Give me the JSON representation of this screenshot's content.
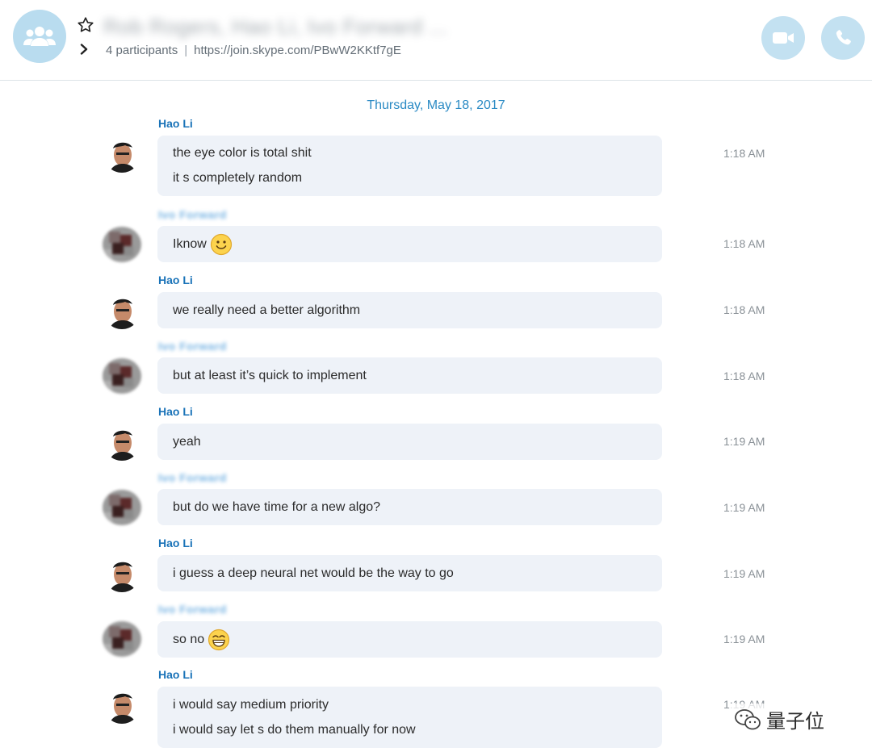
{
  "header": {
    "title_obscured": "Rob Rogers, Hao Li, Ivo Forward ...",
    "participants": "4 participants",
    "separator": "|",
    "join_link": "https://join.skype.com/PBwW2KKtf7gE",
    "icons": {
      "group_avatar": "group-people-icon",
      "favorite": "star-icon",
      "expand": "chevron-right-icon",
      "video_call": "video-camera-icon",
      "audio_call": "phone-icon"
    },
    "colors": {
      "avatar_bg": "#b9dcef",
      "call_bg": "#c3e1f1"
    }
  },
  "date_separator": "Thursday, May 18, 2017",
  "messages": [
    {
      "sender": "Hao Li",
      "lines": [
        "the eye color is total shit",
        "it s completely random"
      ],
      "time": "1:18 AM"
    },
    {
      "sender": "Ivo Forward",
      "lines": [
        "Iknow"
      ],
      "emoji": "smile-emoji-icon",
      "time": "1:18 AM"
    },
    {
      "sender": "Hao Li",
      "lines": [
        "we really need a better algorithm"
      ],
      "time": "1:18 AM"
    },
    {
      "sender": "Ivo Forward",
      "lines": [
        "but at least it’s quick to implement"
      ],
      "time": "1:18 AM"
    },
    {
      "sender": "Hao Li",
      "lines": [
        "yeah"
      ],
      "time": "1:19 AM"
    },
    {
      "sender": "Ivo Forward",
      "lines": [
        "but do we have time for a new algo?"
      ],
      "time": "1:19 AM"
    },
    {
      "sender": "Hao Li",
      "lines": [
        "i guess a deep neural net would be the way to go"
      ],
      "time": "1:19 AM"
    },
    {
      "sender": "Ivo Forward",
      "lines": [
        "so no"
      ],
      "emoji": "grin-emoji-icon",
      "time": "1:19 AM"
    },
    {
      "sender": "Hao Li",
      "lines": [
        "i would say medium priority",
        "i would say let s do them manually for now"
      ],
      "time": "1:19 AM"
    }
  ],
  "watermark": {
    "text": "量子位",
    "icon": "wechat-icon"
  },
  "colors": {
    "sender_name": "#1a73b8",
    "date": "#2a8ac4",
    "bubble": "#eef2f8"
  }
}
